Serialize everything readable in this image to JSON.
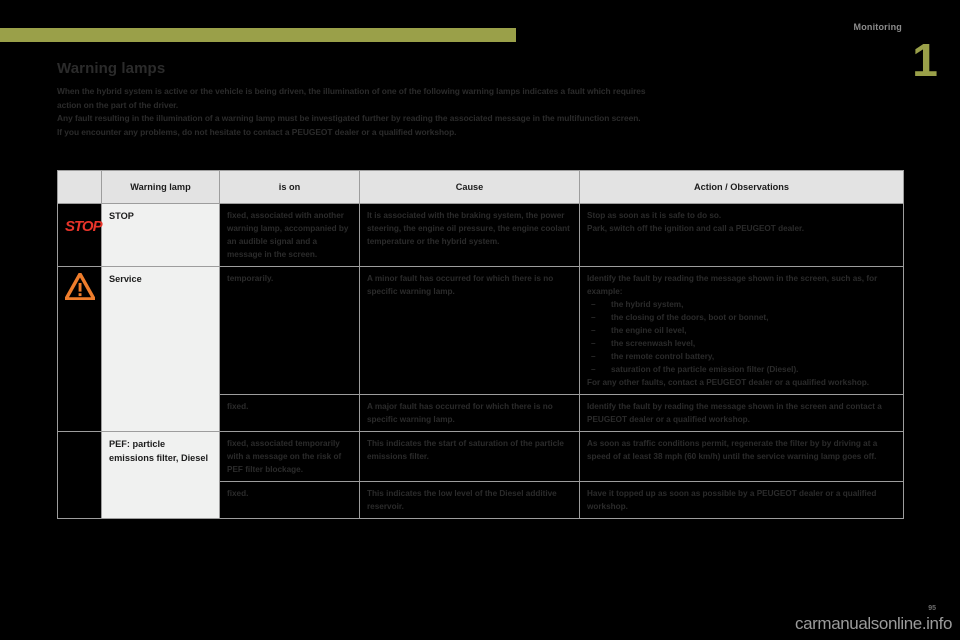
{
  "chapter": {
    "title": "Monitoring",
    "number": "1"
  },
  "page": {
    "title": "Warning lamps",
    "intro_lines": [
      "When the hybrid system is active or the vehicle is being driven, the illumination of one of the following warning lamps indicates a fault which requires",
      "action on the part of the driver.",
      "Any fault resulting in the illumination of a warning lamp must be investigated further by reading the associated message in the multifunction screen.",
      "If you encounter any problems, do not hesitate to contact a PEUGEOT dealer or a qualified workshop."
    ],
    "page_number": "95",
    "watermark": "carmanualsonline.info"
  },
  "table": {
    "headers": {
      "icon": "",
      "lamp": "Warning lamp",
      "is_on": "is on",
      "cause": "Cause",
      "action": "Action / Observations"
    },
    "rows": [
      {
        "icon_name": "stop-warning-icon",
        "icon_glyph": "STOP",
        "lamp": "STOP",
        "is_on": "fixed, associated with another warning lamp, accompanied by an audible signal and a message in the screen.",
        "cause": "It is associated with the braking system, the power steering, the engine oil pressure, the engine coolant temperature or the hybrid system.",
        "action": "Stop as soon as it is safe to do so.\nPark, switch off the ignition and call a PEUGEOT dealer."
      },
      {
        "icon_name": "service-warning-triangle-icon",
        "icon_glyph": "triangle",
        "lamp": "Service",
        "is_on": "temporarily.",
        "cause": "A minor fault has occurred for which there is no specific warning lamp.",
        "action_intro": "Identify the fault by reading the message shown in the screen, such as, for example:",
        "action_bullets": [
          "the hybrid system,",
          "the closing of the doors, boot or bonnet,",
          "the engine oil level,",
          "the screenwash level,",
          "the remote control battery,",
          "saturation of the particle emission filter (Diesel)."
        ],
        "action_outro": "For any other faults, contact a PEUGEOT dealer or a qualified workshop."
      },
      {
        "icon_name": "",
        "lamp": "",
        "is_on": "fixed.",
        "cause": "A major fault has occurred for which there is no specific warning lamp.",
        "action": "Identify the fault by reading the message shown in the screen and contact a PEUGEOT dealer or a qualified workshop."
      },
      {
        "icon_name": "",
        "lamp": "PEF: particle emissions filter, Diesel",
        "is_on": "fixed, associated temporarily with a message on the risk of PEF filter blockage.",
        "cause": "This indicates the start of saturation of the particle emissions filter.",
        "action": "As soon as traffic conditions permit, regenerate the filter by by driving at a speed of at least 38 mph (60 km/h) until the service warning lamp goes off."
      },
      {
        "icon_name": "",
        "lamp": "",
        "is_on": "fixed.",
        "cause": "This indicates the low level of the Diesel additive reservoir.",
        "action": "Have it topped up as soon as possible by a PEUGEOT dealer or a qualified workshop."
      }
    ]
  },
  "colors": {
    "accent_olive": "#9aa049",
    "stop_red": "#e8342a",
    "warning_orange": "#ef7d2c",
    "header_grey": "#e3e3e3"
  }
}
